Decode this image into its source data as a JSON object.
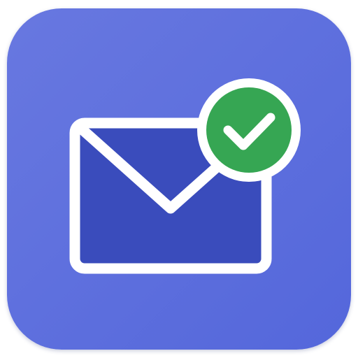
{
  "app_icon": {
    "icon_name": "mail-verified-icon",
    "glyphs": [
      "envelope-icon",
      "checkmark-badge-icon"
    ],
    "colors": {
      "tile_background": "#5467db",
      "tile_highlight": "#6878e0",
      "envelope_fill": "#3a4cbc",
      "envelope_stroke": "#ffffff",
      "badge_ring": "#ffffff",
      "badge_fill": "#36a653",
      "check_mark": "#ffffff"
    }
  }
}
